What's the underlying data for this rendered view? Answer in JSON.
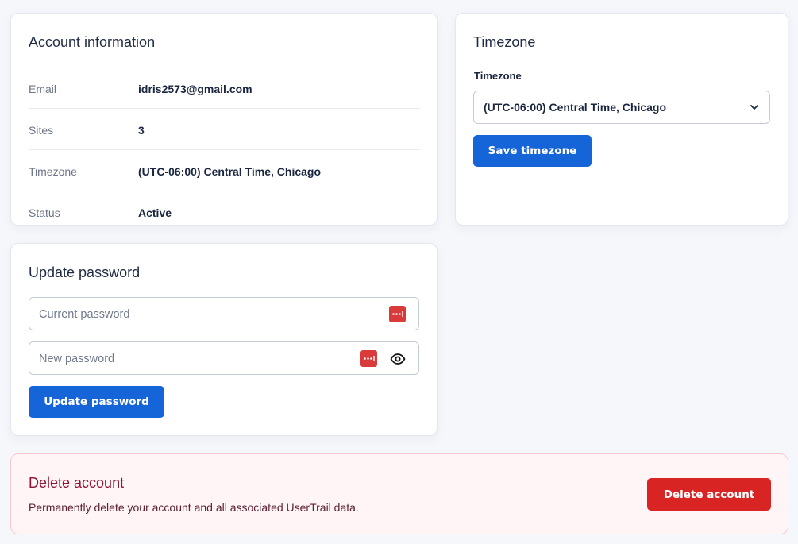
{
  "account": {
    "title": "Account information",
    "rows": [
      {
        "label": "Email",
        "value": "idris2573@gmail.com"
      },
      {
        "label": "Sites",
        "value": "3"
      },
      {
        "label": "Timezone",
        "value": "(UTC-06:00) Central Time, Chicago"
      },
      {
        "label": "Status",
        "value": "Active"
      }
    ]
  },
  "timezone": {
    "title": "Timezone",
    "field_label": "Timezone",
    "selected": "(UTC-06:00) Central Time, Chicago",
    "save_label": "Save timezone"
  },
  "password": {
    "title": "Update password",
    "current_placeholder": "Current password",
    "new_placeholder": "New password",
    "update_label": "Update password"
  },
  "delete": {
    "title": "Delete account",
    "description": "Permanently delete your account and all associated UserTrail data.",
    "button_label": "Delete account"
  },
  "colors": {
    "primary": "#1565d8",
    "danger": "#d92424",
    "danger_bg": "#fff4f6",
    "password_manager": "#d93a3a"
  },
  "icons": {
    "select_chevron": "chevron-down-icon",
    "password_manager": "password-manager-icon",
    "show_password": "eye-icon"
  }
}
